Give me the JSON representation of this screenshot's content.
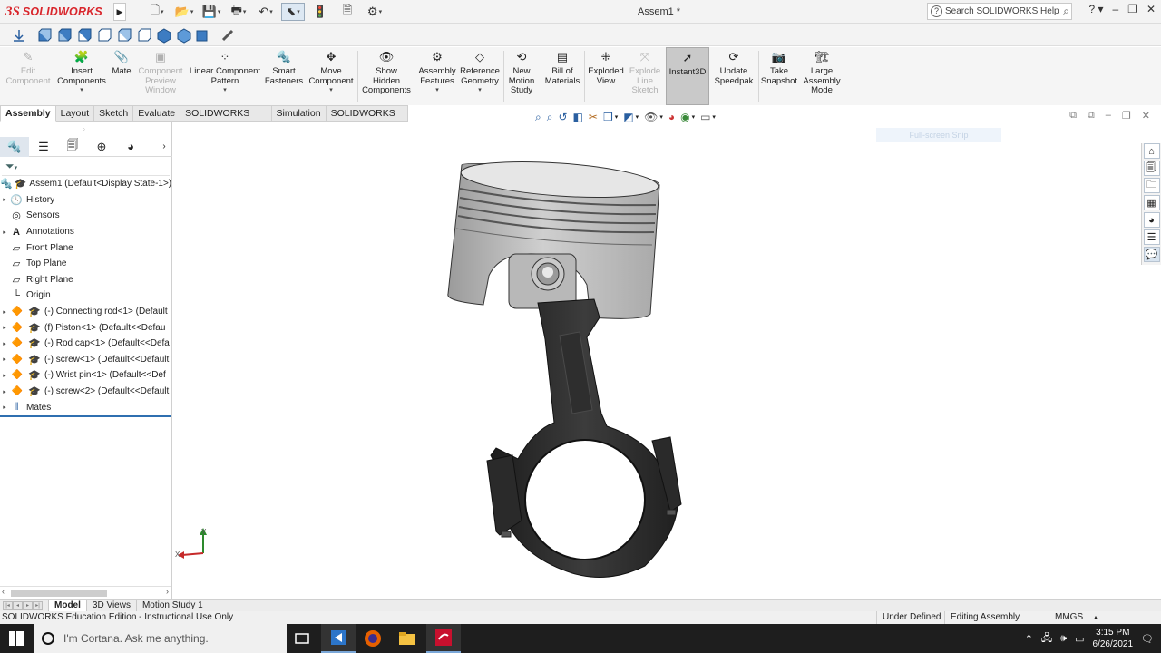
{
  "app": {
    "brand_ds": "3S",
    "brand_name": "SOLIDWORKS",
    "doc_title": "Assem1 *",
    "help_search_placeholder": "Search SOLIDWORKS Help"
  },
  "commands": [
    {
      "id": "edit-component",
      "label": "Edit\nComponent",
      "icon": "edit-component-icon",
      "disabled": true
    },
    {
      "id": "insert-components",
      "label": "Insert\nComponents",
      "icon": "insert-components-icon",
      "dropdown": true
    },
    {
      "id": "mate",
      "label": "Mate",
      "icon": "paperclip-icon"
    },
    {
      "id": "component-preview-window",
      "label": "Component\nPreview\nWindow",
      "icon": "preview-window-icon",
      "disabled": true
    },
    {
      "id": "linear-component-pattern",
      "label": "Linear Component\nPattern",
      "icon": "linear-pattern-icon",
      "dropdown": true
    },
    {
      "id": "smart-fasteners",
      "label": "Smart\nFasteners",
      "icon": "smart-fasteners-icon"
    },
    {
      "id": "move-component",
      "label": "Move\nComponent",
      "icon": "move-component-icon",
      "dropdown": true
    },
    {
      "id": "show-hidden-components",
      "label": "Show\nHidden\nComponents",
      "icon": "show-hidden-icon"
    },
    {
      "id": "assembly-features",
      "label": "Assembly\nFeatures",
      "icon": "assembly-features-icon",
      "dropdown": true
    },
    {
      "id": "reference-geometry",
      "label": "Reference\nGeometry",
      "icon": "reference-geometry-icon",
      "dropdown": true
    },
    {
      "id": "new-motion-study",
      "label": "New\nMotion\nStudy",
      "icon": "motion-study-icon"
    },
    {
      "id": "bill-of-materials",
      "label": "Bill of\nMaterials",
      "icon": "bom-icon"
    },
    {
      "id": "exploded-view",
      "label": "Exploded\nView",
      "icon": "exploded-view-icon"
    },
    {
      "id": "explode-line-sketch",
      "label": "Explode\nLine\nSketch",
      "icon": "explode-line-icon",
      "disabled": true
    },
    {
      "id": "instant3d",
      "label": "Instant3D",
      "icon": "instant3d-icon",
      "active": true
    },
    {
      "id": "update-speedpak",
      "label": "Update\nSpeedpak",
      "icon": "speedpak-icon"
    },
    {
      "id": "take-snapshot",
      "label": "Take\nSnapshot",
      "icon": "camera-icon"
    },
    {
      "id": "large-assembly-mode",
      "label": "Large\nAssembly\nMode",
      "icon": "large-assembly-icon"
    }
  ],
  "tabs": [
    "Assembly",
    "Layout",
    "Sketch",
    "Evaluate",
    "SOLIDWORKS Add-Ins",
    "Simulation",
    "SOLIDWORKS MBD"
  ],
  "active_tab": "Assembly",
  "tree": {
    "root": "Assem1  (Default<Display State-1>)",
    "items": [
      {
        "label": "History",
        "icon": "history-icon",
        "expandable": true
      },
      {
        "label": "Sensors",
        "icon": "sensor-icon",
        "expandable": false
      },
      {
        "label": "Annotations",
        "icon": "annotations-icon",
        "expandable": true
      },
      {
        "label": "Front Plane",
        "icon": "plane-icon",
        "expandable": false
      },
      {
        "label": "Top Plane",
        "icon": "plane-icon",
        "expandable": false
      },
      {
        "label": "Right Plane",
        "icon": "plane-icon",
        "expandable": false
      },
      {
        "label": "Origin",
        "icon": "origin-icon",
        "expandable": false
      }
    ],
    "components": [
      "(-) Connecting rod<1> (Default",
      "(f) Piston<1> (Default<<Defau",
      "(-) Rod cap<1> (Default<<Defa",
      "(-) screw<1> (Default<<Default",
      "(-) Wrist pin<1> (Default<<Def",
      "(-) screw<2> (Default<<Default"
    ],
    "mates": "Mates"
  },
  "graphics": {
    "fullscreen_snip": "Full-screen Snip",
    "triad_y": "Y",
    "triad_x": "X"
  },
  "bottom_tabs": [
    "Model",
    "3D Views",
    "Motion Study 1"
  ],
  "active_bottom_tab": "Model",
  "status": {
    "edition": "SOLIDWORKS Education Edition - Instructional Use Only",
    "defined": "Under Defined",
    "mode": "Editing Assembly",
    "units": "MMGS"
  },
  "taskbar": {
    "cortana_placeholder": "I'm Cortana. Ask me anything.",
    "time": "3:15 PM",
    "date": "6/26/2021"
  },
  "colors": {
    "brand_red": "#d9262c",
    "tree_accent": "#2f6fb0",
    "taskbar": "#1e1e1e"
  }
}
